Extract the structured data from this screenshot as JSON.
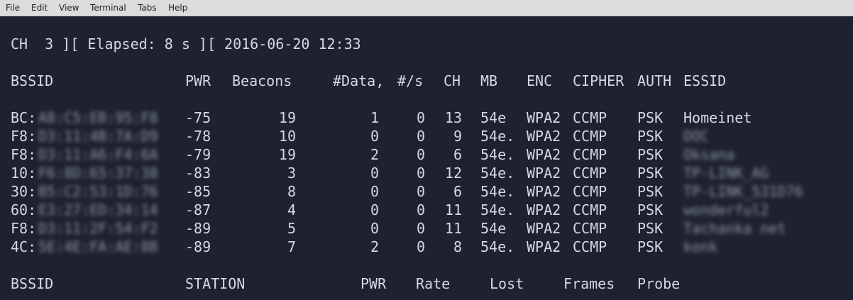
{
  "menu": [
    "File",
    "Edit",
    "View",
    "Terminal",
    "Tabs",
    "Help"
  ],
  "status_line": "CH  3 ][ Elapsed: 8 s ][ 2016-06-20 12:33",
  "ap_headers": {
    "bssid": "BSSID",
    "pwr": "PWR",
    "beacons": "Beacons",
    "data": "#Data,",
    "rate": "#/s",
    "ch": "CH",
    "mb": "MB",
    "enc": "ENC",
    "cipher": "CIPHER",
    "auth": "AUTH",
    "essid": "ESSID"
  },
  "ap_rows": [
    {
      "bssid": "BC:",
      "bssid_hidden": "A8:C5:EB:95:F8",
      "pwr": "-75",
      "beacons": "19",
      "data": "1",
      "rate": "0",
      "ch": "13",
      "mb": "54e",
      "enc": "WPA2",
      "cipher": "CCMP",
      "auth": "PSK",
      "essid": "Homeinet",
      "essid_hidden": false
    },
    {
      "bssid": "F8:",
      "bssid_hidden": "D3:11:4B:7A:D9",
      "pwr": "-78",
      "beacons": "10",
      "data": "0",
      "rate": "0",
      "ch": "9",
      "mb": "54e.",
      "enc": "WPA2",
      "cipher": "CCMP",
      "auth": "PSK",
      "essid": "DOC",
      "essid_hidden": true
    },
    {
      "bssid": "F8:",
      "bssid_hidden": "D3:11:A6:F4:6A",
      "pwr": "-79",
      "beacons": "19",
      "data": "2",
      "rate": "0",
      "ch": "6",
      "mb": "54e.",
      "enc": "WPA2",
      "cipher": "CCMP",
      "auth": "PSK",
      "essid": "Oksana",
      "essid_hidden": true
    },
    {
      "bssid": "10:",
      "bssid_hidden": "F6:8D:65:37:38",
      "pwr": "-83",
      "beacons": "3",
      "data": "0",
      "rate": "0",
      "ch": "12",
      "mb": "54e.",
      "enc": "WPA2",
      "cipher": "CCMP",
      "auth": "PSK",
      "essid": "TP-LINK_AG",
      "essid_hidden": true
    },
    {
      "bssid": "30:",
      "bssid_hidden": "B5:C2:53:1D:76",
      "pwr": "-85",
      "beacons": "8",
      "data": "0",
      "rate": "0",
      "ch": "6",
      "mb": "54e.",
      "enc": "WPA2",
      "cipher": "CCMP",
      "auth": "PSK",
      "essid": "TP-LINK_531D76",
      "essid_hidden": true
    },
    {
      "bssid": "60:",
      "bssid_hidden": "E3:27:ED:34:14",
      "pwr": "-87",
      "beacons": "4",
      "data": "0",
      "rate": "0",
      "ch": "11",
      "mb": "54e.",
      "enc": "WPA2",
      "cipher": "CCMP",
      "auth": "PSK",
      "essid": "wonderful2",
      "essid_hidden": true
    },
    {
      "bssid": "F8:",
      "bssid_hidden": "D3:11:2F:54:F2",
      "pwr": "-89",
      "beacons": "5",
      "data": "0",
      "rate": "0",
      "ch": "11",
      "mb": "54e",
      "enc": "WPA2",
      "cipher": "CCMP",
      "auth": "PSK",
      "essid": "Tachanka net",
      "essid_hidden": true
    },
    {
      "bssid": "4C:",
      "bssid_hidden": "5E:4E:FA:AE:8B",
      "pwr": "-89",
      "beacons": "7",
      "data": "2",
      "rate": "0",
      "ch": "8",
      "mb": "54e.",
      "enc": "WPA2",
      "cipher": "CCMP",
      "auth": "PSK",
      "essid": "konk",
      "essid_hidden": true
    }
  ],
  "station_headers": {
    "bssid": "BSSID",
    "station": "STATION",
    "pwr": "PWR",
    "rate": "Rate",
    "lost": "Lost",
    "frames": "Frames",
    "probe": "Probe"
  }
}
